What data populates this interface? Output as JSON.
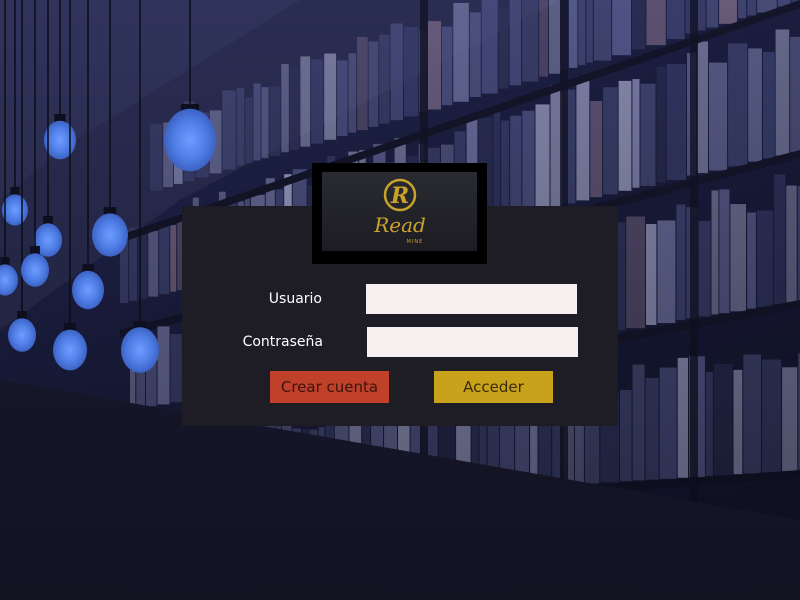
{
  "brand": {
    "logo_mark": "R",
    "logo_word": "Read",
    "logo_sub": "MINE",
    "logo_color": "#c9a22a"
  },
  "form": {
    "username_label": "Usuario",
    "username_value": "",
    "password_label": "Contraseña",
    "password_value": ""
  },
  "actions": {
    "create_label": "Crear cuenta",
    "login_label": "Acceder"
  },
  "colors": {
    "panel": "#1e1d26",
    "create_button": "#c0402a",
    "login_button": "#c9a21c",
    "input_bg": "#f8f0f0",
    "lamp_glow": "#5b8ff0"
  }
}
